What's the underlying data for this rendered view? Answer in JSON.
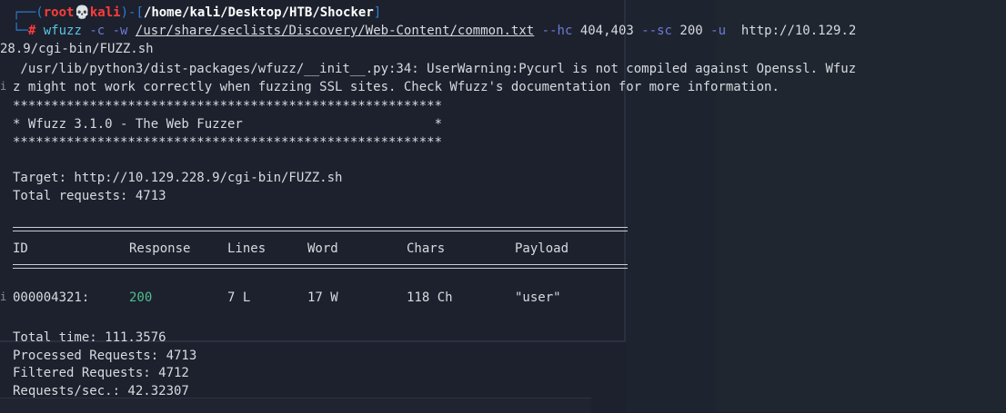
{
  "prompt": {
    "top_corner": "┌──(",
    "user": "root",
    "skull": "💀",
    "host": "kali",
    "mid": ")-[",
    "path": "/home/kali/Desktop/HTB/Shocker",
    "end": "]",
    "bottom_corner": "└─",
    "hash": "#"
  },
  "command": {
    "program": "wfuzz",
    "flag_c": "-c",
    "flag_w": "-w",
    "wordlist": "/usr/share/seclists/Discovery/Web-Content/common.txt",
    "flag_hc": "--hc",
    "hc_value": "404,403",
    "flag_sc": "--sc",
    "sc_value": "200",
    "flag_u": "-u",
    "url_part1": "http://10.129.2",
    "url_part2": "28.9/cgi-bin/FUZZ.sh"
  },
  "warning": {
    "line1": " /usr/lib/python3/dist-packages/wfuzz/__init__.py:34: UserWarning:Pycurl is not compiled against Openssl. Wfuz",
    "line2": "z might not work correctly when fuzzing SSL sites. Check Wfuzz's documentation for more information."
  },
  "banner": {
    "stars": "********************************************************",
    "title": "* Wfuzz 3.1.0 - The Web Fuzzer                         *"
  },
  "target": "Target: http://10.129.228.9/cgi-bin/FUZZ.sh",
  "total_requests": "Total requests: 4713",
  "table": {
    "headers": {
      "id": "ID",
      "response": "Response",
      "lines": "Lines",
      "word": "Word",
      "chars": "Chars",
      "payload": "Payload"
    },
    "rows": [
      {
        "id": "000004321:",
        "response": "200",
        "lines": "7 L",
        "word": "17 W",
        "chars": "118 Ch",
        "payload": "\"user\""
      }
    ]
  },
  "summary": {
    "total_time": "Total time: 111.3576",
    "processed": "Processed Requests: 4713",
    "filtered": "Filtered Requests: 4712",
    "rate": "Requests/sec.: 42.32307"
  },
  "colors": {
    "background": "#1c212d",
    "prompt_frame": "#2e7cd6",
    "root_user": "#ff3c3c",
    "command": "#5cc2e6",
    "option": "#6e7bd8",
    "status_200": "#4fbf8f"
  }
}
